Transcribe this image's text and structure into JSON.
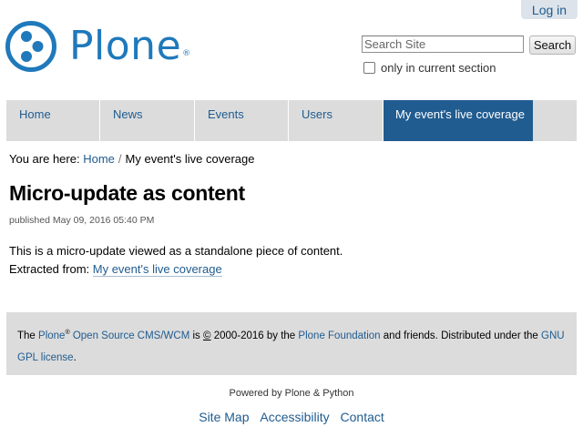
{
  "header": {
    "login_label": "Log in",
    "logo_text": "Plone",
    "logo_reg": "®",
    "brand_color": "#1f79bb"
  },
  "search": {
    "placeholder": "Search Site",
    "value": "",
    "button_label": "Search",
    "section_only_label": "only in current section",
    "section_only_checked": false
  },
  "nav": {
    "items": [
      {
        "label": "Home",
        "selected": false
      },
      {
        "label": "News",
        "selected": false
      },
      {
        "label": "Events",
        "selected": false
      },
      {
        "label": "Users",
        "selected": false
      },
      {
        "label": "My event's live coverage",
        "selected": true
      }
    ],
    "selected_color": "#205c90"
  },
  "breadcrumb": {
    "prefix": "You are here:",
    "items": [
      "Home",
      "My event's live coverage"
    ],
    "separator": "/"
  },
  "content": {
    "title": "Micro-update as content",
    "byline": "published May 09, 2016 05:40 PM",
    "body": "This is a micro-update viewed as a standalone piece of content.",
    "extracted_prefix": "Extracted from:",
    "extracted_link": "My event's live coverage"
  },
  "footer": {
    "the": "The",
    "plone_link": "Plone",
    "reg": "®",
    "cms_link": "Open Source CMS/WCM",
    "is": "is",
    "copyright_symbol": "©",
    "years_by": "2000-2016 by the",
    "foundation_link": "Plone Foundation",
    "friends": "and friends. Distributed under the",
    "license_link": "GNU GPL license",
    "period": "."
  },
  "colophon": {
    "powered_by": "Powered by Plone & Python"
  },
  "site_actions": [
    "Site Map",
    "Accessibility",
    "Contact"
  ]
}
